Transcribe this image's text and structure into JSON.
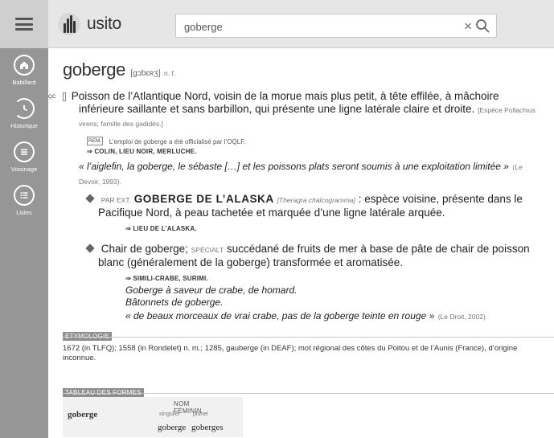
{
  "app": {
    "logo_text": "usito",
    "menu_icon": "hamburger-icon"
  },
  "search": {
    "value": "goberge",
    "clear_glyph": "×"
  },
  "sidebar": {
    "items": [
      {
        "label": "Babillard",
        "icon": "home-icon"
      },
      {
        "label": "Historique",
        "icon": "history-icon"
      },
      {
        "label": "Voisinage",
        "icon": "neighborhood-icon"
      },
      {
        "label": "Listes",
        "icon": "list-icon"
      }
    ]
  },
  "entry": {
    "headword": "goberge",
    "phonetic": "[ɡɔbɛʀʒ]",
    "pos": "n. f.",
    "sense1": {
      "tag": "QC",
      "definition": "Poisson de l’Atlantique Nord, voisin de la morue mais plus petit, à tête effilée, à mâchoire inférieure saillante et sans barbillon, qui présente une ligne latérale claire et droite.",
      "species_note": "[Espèce Pollachius virens; famille des gadidés.]",
      "rem_tag": "REM.",
      "rem_text": "L’emploi de goberge a été officialisé par l’OQLF.",
      "see": "⇒ COLIN, LIEU NOIR, MERLUCHE.",
      "example": "« l’aiglefin, la goberge, le sébaste […] et les poissons plats seront soumis à une exploitation limitée »",
      "example_source": "(Le Devoir, 1993)."
    },
    "subsense1": {
      "prefix": "PAR EXT.",
      "term": "GOBERGE DE L’ALASKA",
      "latin": "[Theragra chalcogramma]",
      "definition": ": espèce voisine, présente dans le Pacifique Nord, à peau tachetée et marquée d’une ligne latérale arquée.",
      "see": "⇒ LIEU DE L’ALASKA."
    },
    "subsense2": {
      "definition_a": "Chair de goberge;",
      "special": "SPÉCIALT",
      "definition_b": "succédané de fruits de mer à base de pâte de chair de poisson blanc (généralement de la goberge) transformée et aromatisée.",
      "see": "⇒ SIMILI-CRABE, SURIMI.",
      "ex1": "Goberge à saveur de crabe, de homard.",
      "ex2": "Bâtonnets de goberge.",
      "ex3": "« de beaux morceaux de vrai crabe, pas de la goberge teinte en rouge »",
      "ex3_source": "(Le Droit, 2002)."
    }
  },
  "etymology": {
    "label": "ÉTYMOLOGIE",
    "text": "1672 (in TLFQ); 1558 (in Rondelet) n. m.; 1285, gauberge (in DEAF); mot régional des côtes du Poitou et de l’Aunis (France), d’origine inconnue."
  },
  "forms": {
    "label": "TABLEAU DES FORMES",
    "header": "NOM FÉMININ",
    "word": "goberge",
    "singular_label": "singulier",
    "plural_label": "pluriel",
    "singular": "goberge",
    "plural": "goberges"
  }
}
